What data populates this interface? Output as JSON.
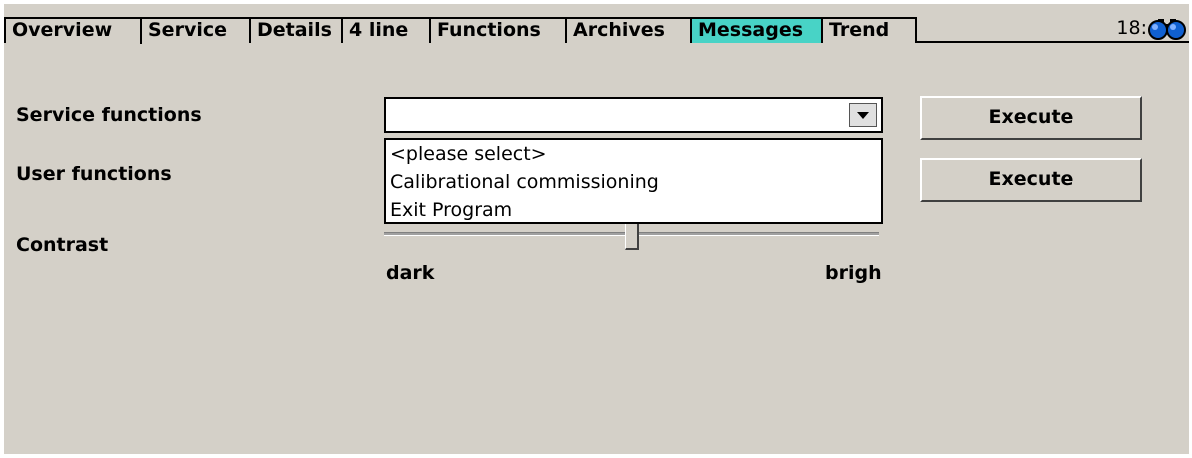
{
  "tabs": [
    {
      "label": "Overview",
      "active": false,
      "highlight": false
    },
    {
      "label": "Service",
      "active": true,
      "highlight": false
    },
    {
      "label": "Details",
      "active": false,
      "highlight": false
    },
    {
      "label": "4 line",
      "active": false,
      "highlight": false
    },
    {
      "label": "Functions",
      "active": false,
      "highlight": false
    },
    {
      "label": "Archives",
      "active": false,
      "highlight": false
    },
    {
      "label": "Messages",
      "active": false,
      "highlight": true
    },
    {
      "label": "Trend",
      "active": false,
      "highlight": false
    }
  ],
  "clock": "18:",
  "status_icon": "binocular-icon",
  "service_functions": {
    "label": "Service functions",
    "selected_value": "",
    "options": [
      "<please select>",
      "Calibrational commissioning",
      "Exit Program"
    ],
    "execute_label": "Execute"
  },
  "user_functions": {
    "label": "User functions",
    "execute_label": "Execute"
  },
  "contrast": {
    "label": "Contrast",
    "min_label": "dark",
    "max_label": "brigh",
    "level": 0.5
  },
  "colors": {
    "background": "#d4d0c8",
    "tab_highlight": "#48d3c6"
  }
}
